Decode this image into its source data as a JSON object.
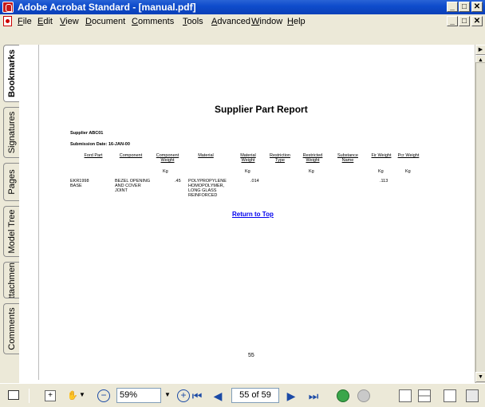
{
  "window": {
    "title": "Adobe Acrobat Standard - [manual.pdf]",
    "minimize": "_",
    "maximize": "□",
    "close": "✕"
  },
  "menu": {
    "items": [
      "File",
      "Edit",
      "View",
      "Document",
      "Comments",
      "Tools",
      "Advanced",
      "Window",
      "Help"
    ]
  },
  "side_tabs": [
    "Bookmarks",
    "Signatures",
    "Pages",
    "Model Tree",
    "Attachments",
    "Comments"
  ],
  "document": {
    "report_title": "Supplier Part Report",
    "supplier": "Supplier ABC01",
    "submission_date": "Submission Date: 16-JAN-00",
    "headers": [
      "Ford Part",
      "Component",
      "Component Weight",
      "Material",
      "Material Weight",
      "Restriction Type",
      "Restricted Weight",
      "Substance Name",
      "Fir Weight",
      "Pcr Weight"
    ],
    "units": [
      "",
      "",
      "Kg",
      "",
      "Kg",
      "",
      "Kg",
      "",
      "Kg",
      "Kg"
    ],
    "row": {
      "ford_part": "EKR1998 BASE",
      "component": "BEZEL OPENING AND COVER JOINT",
      "component_weight": ".45",
      "material": "POLYPROPYLENE HOMOPOLYMER, LONG GLASS REINFORCED",
      "material_weight": ".014",
      "fir_weight": ".113"
    },
    "return_link": "Return to Top",
    "page_number": "55"
  },
  "toolbar": {
    "zoom_value": "59%",
    "page_field": "55 of 59"
  },
  "colors": {
    "titlebar": "#0a3fb8",
    "link": "#0000ee",
    "chrome": "#ece9d8"
  }
}
